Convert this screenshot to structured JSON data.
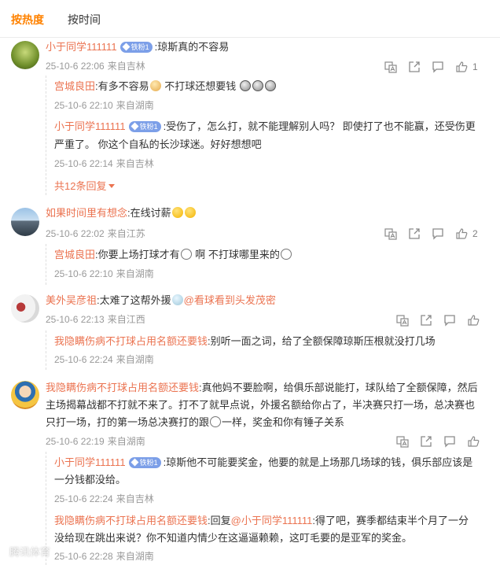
{
  "tabs": {
    "hot": "按热度",
    "time": "按时间"
  },
  "accent": "#ff8200",
  "name_color": "#eb7350",
  "comments": [
    {
      "user": "小于同学111111",
      "badge": "铁粉1",
      "text": ":琼斯真的不容易",
      "date": "25-10-6 22:06",
      "loc": "来自吉林",
      "likes": "1",
      "replies": [
        {
          "user": "宫城良田",
          "text1": ":有多不容易",
          "text2": "不打球还想要钱",
          "date": "25-10-6 22:10",
          "loc": "来自湖南"
        },
        {
          "user": "小于同学111111",
          "badge": "铁粉1",
          "text": ":受伤了，怎么打，就不能理解别人吗？ 即使打了也不能赢，还受伤更",
          "text_cont": "严重了。 你这个自私的长沙球迷。好好想想吧",
          "date": "25-10-6 22:14",
          "loc": "来自吉林"
        }
      ],
      "more": "共12条回复"
    },
    {
      "user": "如果时间里有想念",
      "text": ":在线讨薪",
      "date": "25-10-6 22:02",
      "loc": "来自江苏",
      "likes": "2",
      "replies": [
        {
          "user": "宫城良田",
          "text1": ":你要上场打球才有",
          "text2": "啊 不打球哪里来的",
          "date": "25-10-6 22:10",
          "loc": "来自湖南"
        }
      ]
    },
    {
      "user": "美外吴彦祖",
      "text": ":太难了这帮外援",
      "mention": "@看球看到头发茂密",
      "date": "25-10-6 22:13",
      "loc": "来自江西",
      "likes": "",
      "replies": [
        {
          "user": "我隐瞒伤病不打球占用名额还要钱",
          "text": ":别听一面之词，给了全额保障琼斯压根就没打几场",
          "date": "25-10-6 22:24",
          "loc": "来自湖南"
        }
      ]
    },
    {
      "user": "我隐瞒伤病不打球占用名额还要钱",
      "text": ":真他妈不要脸啊，给俱乐部说能打，球队给了全额保障，然后",
      "text_l2": "主场揭幕战都不打就不来了。打不了就早点说，外援名额给你占了，半决赛只打一场，总决赛也",
      "text_l3a": "只打一场，打的第一场总决赛打的跟",
      "text_l3b": "一样，奖金和你有锤子关系",
      "date": "25-10-6 22:19",
      "loc": "来自湖南",
      "likes": "",
      "replies": [
        {
          "user": "小于同学111111",
          "badge": "铁粉1",
          "text": ":琼斯他不可能要奖金，他要的就是上场那几场球的钱，俱乐部应该是",
          "text_cont": "一分钱都没给。",
          "date": "25-10-6 22:24",
          "loc": "来自吉林"
        },
        {
          "user": "我隐瞒伤病不打球占用名额还要钱",
          "pre": ":回复",
          "mention": "@小于同学111111",
          "text": ":得了吧，赛季都结束半个月了一分",
          "text_cont": "没给现在跳出来说？你不知道内情少在这逼逼赖赖，这叮毛要的是亚军的奖金。",
          "date": "25-10-6 22:28",
          "loc": "来自湖南"
        }
      ]
    }
  ],
  "watermark": "腾讯体育"
}
